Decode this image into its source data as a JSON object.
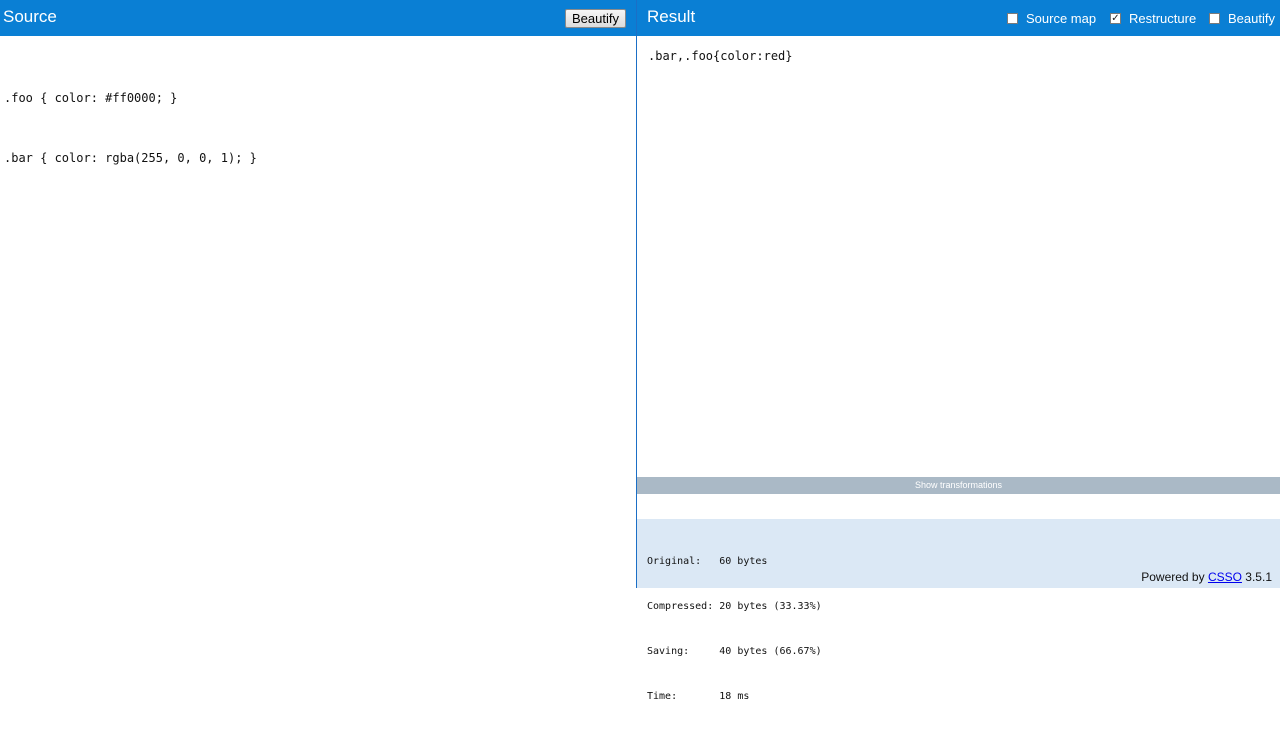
{
  "source": {
    "title": "Source",
    "beautify_label": "Beautify",
    "code_lines": [
      ".foo { color: #ff0000; }",
      ".bar { color: rgba(255, 0, 0, 1); }"
    ]
  },
  "result": {
    "title": "Result",
    "options": [
      {
        "label": "Source map",
        "checked": false
      },
      {
        "label": "Restructure",
        "checked": true
      },
      {
        "label": "Beautify",
        "checked": false
      }
    ],
    "code": ".bar,.foo{color:red}",
    "show_transformations_label": "Show transformations",
    "stats": [
      {
        "label": "Original:",
        "value": "60 bytes"
      },
      {
        "label": "Compressed:",
        "value": "20 bytes (33.33%)"
      },
      {
        "label": "Saving:",
        "value": "40 bytes (66.67%)"
      },
      {
        "label": "Time:",
        "value": "18 ms"
      }
    ],
    "powered_prefix": "Powered by",
    "powered_link": "CSSO",
    "version": "3.5.1"
  },
  "colors": {
    "header_bg": "#0a7fd4",
    "stats_bg": "#dbe8f5",
    "show_bar_bg": "#aab9c6"
  }
}
